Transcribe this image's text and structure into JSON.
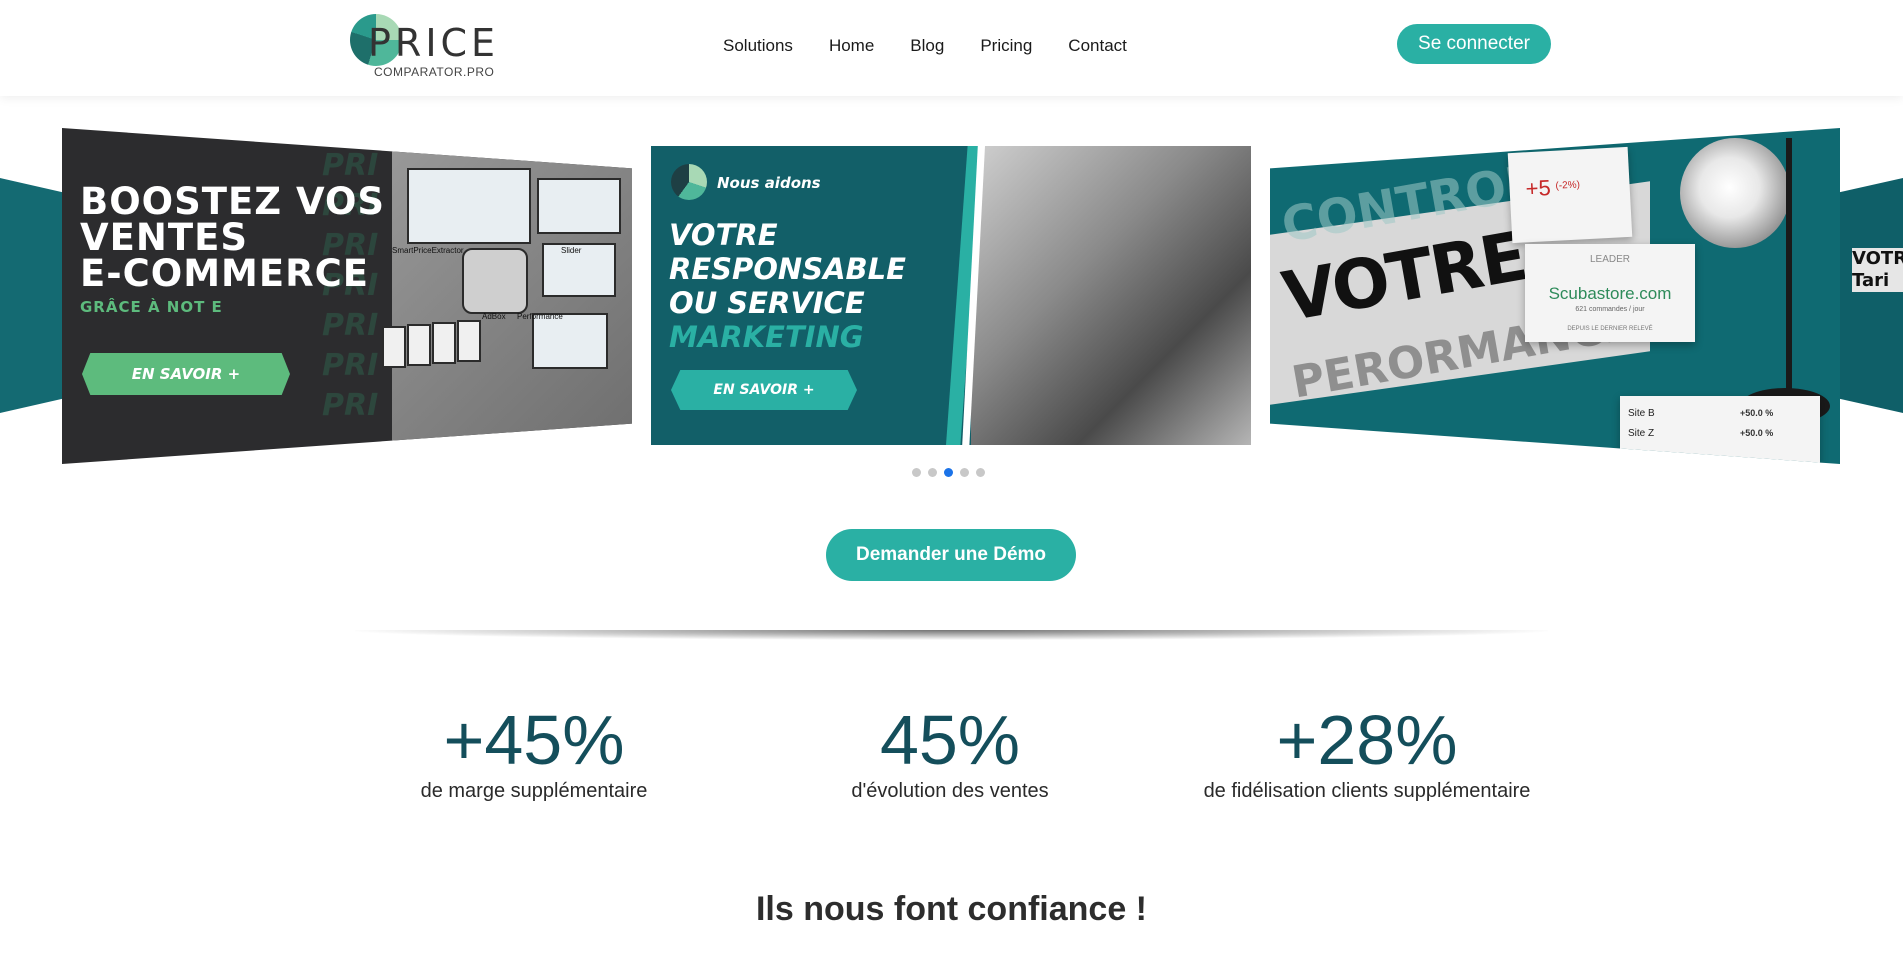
{
  "brand": {
    "logo_text": "PRICE",
    "logo_sub": "COMPARATOR.PRO",
    "teal": "#2ab0a4",
    "dark_teal": "#144e5b"
  },
  "nav": {
    "items": [
      "Solutions",
      "Home",
      "Blog",
      "Pricing",
      "Contact"
    ],
    "login_label": "Se connecter"
  },
  "carousel": {
    "slide1": {
      "title_lines": [
        "BOOSTEZ VOS",
        "VENTES",
        "E-COMMERCE"
      ],
      "subtitle": "GRÂCE À NOT  E",
      "cta": "EN SAVOIR +",
      "screens": [
        "SmartPriceExtractor",
        "Slider",
        "AdBox",
        "Performance"
      ],
      "bg_word": "PRI"
    },
    "slide2": {
      "tag": "Nous aidons",
      "title_lines": [
        "VOTRE",
        "RESPONSABLE",
        "OU SERVICE"
      ],
      "title_accent": "MARKETING",
      "cta": "EN SAVOIR +"
    },
    "slide3": {
      "word1": "CONTROLEZ",
      "word2": "VOTRE",
      "word3": "PERORMANCE",
      "perf_value": "+5",
      "perf_pct": "(-2%)",
      "leader_label": "LEADER",
      "leader_site": "Scubastore.com",
      "leader_sub": "621 commandes / jour",
      "leader_since": "DEPUIS LE DERNIER RELEVÉ",
      "rows": [
        {
          "name": "Site B",
          "value": "+50.0 %"
        },
        {
          "name": "Site Z",
          "value": "+50.0 %"
        }
      ]
    },
    "right_edge_text": "VOTRE Tari",
    "dots": 5,
    "active_dot": 3
  },
  "demo_button": "Demander une Démo",
  "stats": [
    {
      "value": "+45%",
      "label": "de marge supplémentaire"
    },
    {
      "value": "45%",
      "label": "d'évolution des ventes"
    },
    {
      "value": "+28%",
      "label": "de fidélisation clients supplémentaire"
    }
  ],
  "trust_title": "Ils nous font confiance !"
}
